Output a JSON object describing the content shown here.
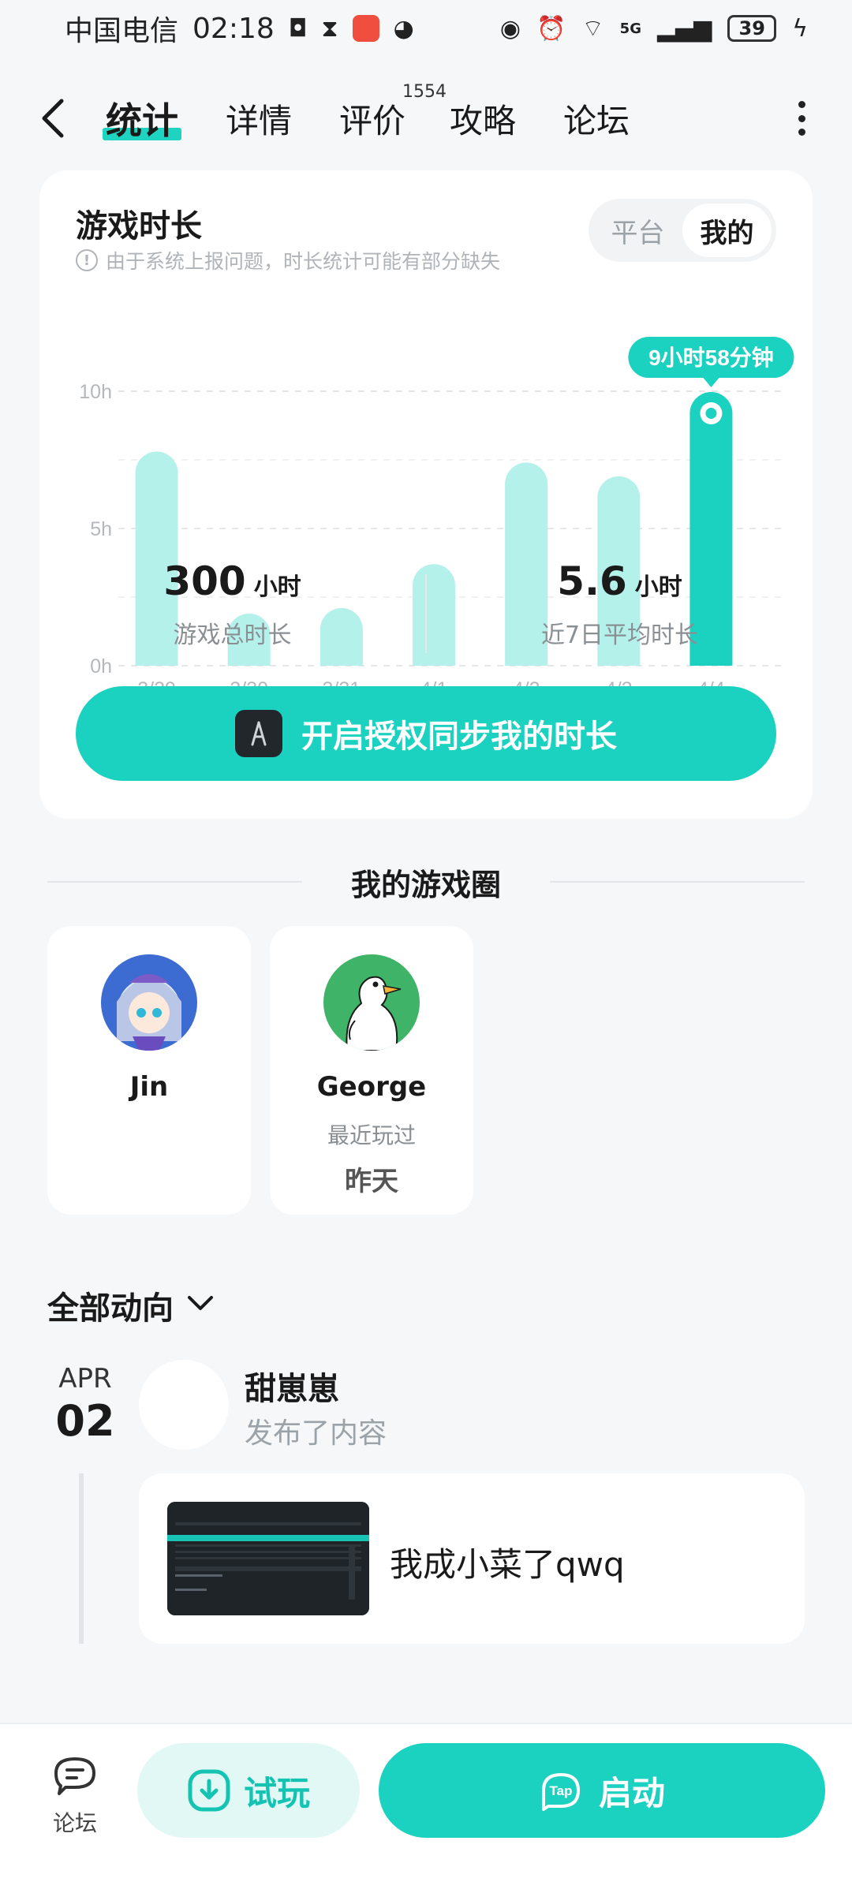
{
  "status_bar": {
    "carrier": "中国电信",
    "time": "02:18",
    "network": "5G",
    "battery": "39"
  },
  "nav": {
    "tabs": [
      {
        "label": "统计",
        "active": true
      },
      {
        "label": "详情"
      },
      {
        "label": "评价",
        "badge": "1554"
      },
      {
        "label": "攻略"
      },
      {
        "label": "论坛"
      }
    ]
  },
  "stats": {
    "title": "游戏时长",
    "notice": "由于系统上报问题，时长统计可能有部分缺失",
    "toggle": {
      "platform": "平台",
      "mine": "我的",
      "active": "mine"
    },
    "tooltip": "9小时58分钟",
    "total": {
      "value": "300",
      "unit": "小时",
      "label": "游戏总时长"
    },
    "average": {
      "value": "5.6",
      "unit": "小时",
      "label": "近7日平均时长"
    },
    "auth_button": "开启授权同步我的时长"
  },
  "chart_data": {
    "type": "bar",
    "categories": [
      "3/29",
      "3/30",
      "3/31",
      "4/1",
      "4/2",
      "4/3",
      "4/4"
    ],
    "values": [
      7.8,
      1.9,
      2.1,
      3.7,
      7.4,
      6.9,
      9.97
    ],
    "highlight_index": 6,
    "yticks": [
      "0h",
      "5h",
      "10h"
    ],
    "ylim": [
      0,
      10
    ],
    "colors": {
      "bar": "#b4f1ea",
      "highlight": "#1bd1c0"
    }
  },
  "game_circle": {
    "title": "我的游戏圈",
    "friends": [
      {
        "name": "Jin"
      },
      {
        "name": "George",
        "sub": "最近玩过",
        "time": "昨天"
      }
    ]
  },
  "activity": {
    "title": "全部动向",
    "post": {
      "month": "APR",
      "day": "02",
      "user": "甜崽崽",
      "action": "发布了内容",
      "text": "我成小菜了qwq"
    }
  },
  "bottom_bar": {
    "forum": "论坛",
    "trial": "试玩",
    "launch": "启动"
  }
}
